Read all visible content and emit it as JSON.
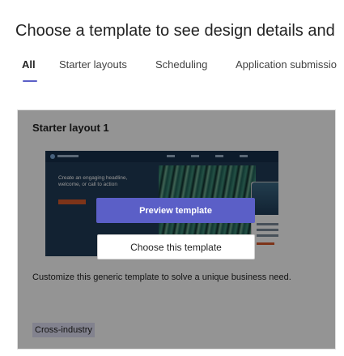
{
  "header": {
    "title": "Choose a template to see design details and"
  },
  "tabs": [
    {
      "label": "All",
      "active": true
    },
    {
      "label": "Starter layouts",
      "active": false
    },
    {
      "label": "Scheduling",
      "active": false
    },
    {
      "label": "Application submissio",
      "active": false
    }
  ],
  "card": {
    "title": "Starter layout 1",
    "preview": {
      "headline": "Create an engaging headline, welcome, or call to action"
    },
    "overlay": {
      "preview_label": "Preview template",
      "choose_label": "Choose this template"
    },
    "description": "Customize this generic template to solve a unique business need.",
    "category": "Cross-industry"
  },
  "colors": {
    "accent": "#5b5fc7",
    "badge_bg": "#e0e0f5"
  }
}
